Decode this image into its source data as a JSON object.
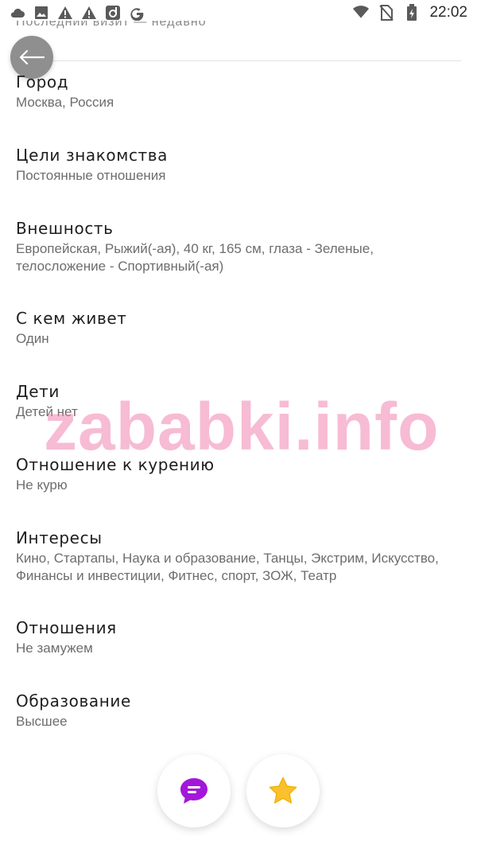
{
  "status_bar": {
    "time": "22:02",
    "left_icons": [
      "cloud-icon",
      "image-icon",
      "warning-icon",
      "warning-icon",
      "app-icon",
      "google-icon"
    ],
    "right_icons": [
      "wifi-icon",
      "no-sim-icon",
      "battery-charging-icon"
    ]
  },
  "header": {
    "partial_text": "Последний визит — недавно"
  },
  "profile": {
    "sections": [
      {
        "title": "Город",
        "value": "Москва, Россия"
      },
      {
        "title": "Цели знакомства",
        "value": "Постоянные отношения"
      },
      {
        "title": "Внешность",
        "value": "Европейская, Рыжий(-ая), 40 кг, 165 см, глаза - Зеленые, телосложение - Спортивный(-ая)"
      },
      {
        "title": "С кем живет",
        "value": "Один"
      },
      {
        "title": "Дети",
        "value": "Детей нет"
      },
      {
        "title": "Отношение к курению",
        "value": "Не курю"
      },
      {
        "title": "Интересы",
        "value": "Кино, Стартапы, Наука и образование, Танцы, Экстрим, Искусство, Финансы и инвестиции, Фитнес, спорт, ЗОЖ, Театр"
      },
      {
        "title": "Отношения",
        "value": "Не замужем"
      },
      {
        "title": "Образование",
        "value": "Высшее"
      }
    ]
  },
  "watermark": "zababki.info",
  "actions": {
    "chat_icon": "chat-bubble-icon",
    "favorite_icon": "star-icon"
  },
  "colors": {
    "chat_accent": "#a417d9",
    "star_accent": "#fbc02d",
    "watermark": "#f078aa"
  }
}
